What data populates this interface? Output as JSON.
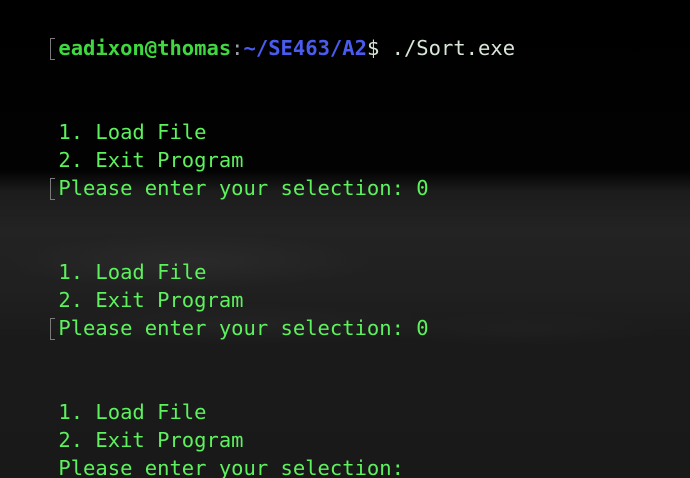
{
  "prompt": {
    "user_host": "eadixon@thomas",
    "separator": ":",
    "path": "~/SE463/A2",
    "symbol": "$",
    "command": " ./Sort.exe"
  },
  "blocks": [
    {
      "option_1": "1. Load File",
      "option_2": "2. Exit Program",
      "prompt_text": "Please enter your selection: 0"
    },
    {
      "option_1": "1. Load File",
      "option_2": "2. Exit Program",
      "prompt_text": "Please enter your selection: 0"
    },
    {
      "option_1": "1. Load File",
      "option_2": "2. Exit Program",
      "prompt_text": "Please enter your selection: "
    }
  ],
  "colors": {
    "output_text": "#5df25d",
    "user_host": "#3fd83f",
    "path": "#4a5cf0",
    "command": "#d8e6d8"
  }
}
